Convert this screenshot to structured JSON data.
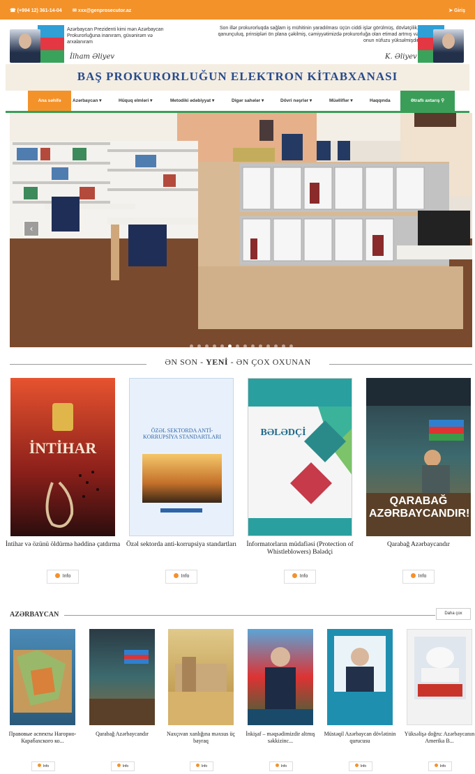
{
  "topbar": {
    "phone": "(+994 12) 361-14-04",
    "email": "xxx@genprosecutor.az",
    "lang": "Giriş"
  },
  "banner": {
    "left_quote": "Azərbaycan Prezidenti kimi mən Azərbaycan Prokurorluğuna inanıram, güvənirəm və arxalanıram",
    "right_quote": "Son illər prokurorluqda sağlam iş mühitinin yaradılması üçün ciddi işlər görülmüş, dövlətçilik, qanunçuluq, prinsipləri ön plana çəkilmiş, cəmiyyətimizdə prokurorluğa olan etimad artmış və onun nüfuzu yüksəlmişdir",
    "signature_left": "İlham Əliyev",
    "signature_right": "K. Əliyev"
  },
  "site_title": "BAŞ PROKURORLUĞUN ELEKTRON KİTABXANASI",
  "nav": {
    "items": [
      "Ana səhifə",
      "Azərbaycan",
      "Hüquq elmləri",
      "Metodiki ədəbiyyat",
      "Digər sahələr",
      "Dövri nəşrlər",
      "Müəlliflər",
      "Haqqında"
    ],
    "search": "Ətraflı axtarış"
  },
  "hero": {
    "slides": 14,
    "active": 5
  },
  "section_new": {
    "title_left": "ƏN SON",
    "title_mid": "YENİ",
    "title_right": "ƏN ÇOX OXUNAN"
  },
  "featured": [
    {
      "title": "İntihar və özünü öldürmə həddinə çatdırma",
      "cover_title": "İNTİHAR",
      "info": "Info"
    },
    {
      "title": "Özəl sektorda anti-korrupsiya standartları",
      "cover_title": "ÖZƏL SEKTORDA ANTİ-KORRUPSİYA STANDARTLARI",
      "info": "Info"
    },
    {
      "title": "İnformatorların müdafiəsi (Protection of Whistleblowers) Bələdçi",
      "cover_title": "BƏLƏDÇİ",
      "info": "Info"
    },
    {
      "title": "Qarabağ Azərbaycandır",
      "cover_title": "QARABAĞ AZƏRBAYCANDIR!",
      "info": "Info"
    }
  ],
  "section_az": {
    "title": "AZƏRBAYCAN",
    "all_label": "Daha çox"
  },
  "az_books": [
    {
      "title": "Правовые аспекты Нагорно-Карабахского ко...",
      "info": "Info"
    },
    {
      "title": "Qarabağ Azərbaycandır",
      "info": "Info"
    },
    {
      "title": "Naxçıvan xanlığına məxsus üç bayraq",
      "info": "Info"
    },
    {
      "title": "İnkişaf – məqsədimizdir altmış səkkizinc...",
      "info": "Info"
    },
    {
      "title": "Müstəqil Azərbaycan dövlətinin qurucusu",
      "info": "Info"
    },
    {
      "title": "Yüksəlişə doğru: Azərbaycanın Amerika B...",
      "info": "Info"
    }
  ]
}
